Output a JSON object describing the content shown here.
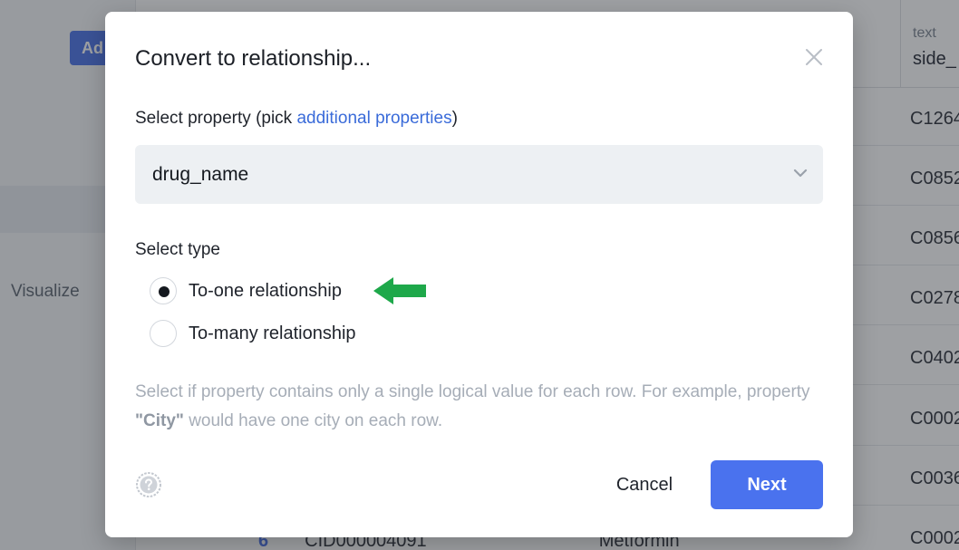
{
  "background": {
    "add_button_label": "Ad",
    "nav_visualize_label": "Visualize",
    "column": {
      "type_label": "text",
      "name": "side_"
    },
    "cells": [
      "C1264",
      "C0852",
      "C0856",
      "C0278",
      "C0402",
      "C0002",
      "C0036",
      "C0002"
    ],
    "bottom_row": {
      "row_number": "6",
      "id": "CID000004091",
      "name": "Metformin"
    }
  },
  "modal": {
    "title": "Convert to relationship...",
    "close_icon": "close-icon",
    "property_label_prefix": "Select property (pick ",
    "property_label_link": "additional properties",
    "property_label_suffix": ")",
    "select": {
      "value": "drug_name",
      "icon": "chevron-down-icon"
    },
    "type_label": "Select type",
    "types": [
      {
        "label": "To-one relationship",
        "checked": true
      },
      {
        "label": "To-many relationship",
        "checked": false
      }
    ],
    "annotation_arrow_color": "#1ea84a",
    "help_text_part1": "Select if property contains only a single logical value for each row. For example, property ",
    "help_text_bold": "\"City\"",
    "help_text_part2": " would have one city on each row.",
    "help_icon": "question-circle-icon",
    "cancel_label": "Cancel",
    "next_label": "Next",
    "accent_color": "#4a72ee"
  }
}
